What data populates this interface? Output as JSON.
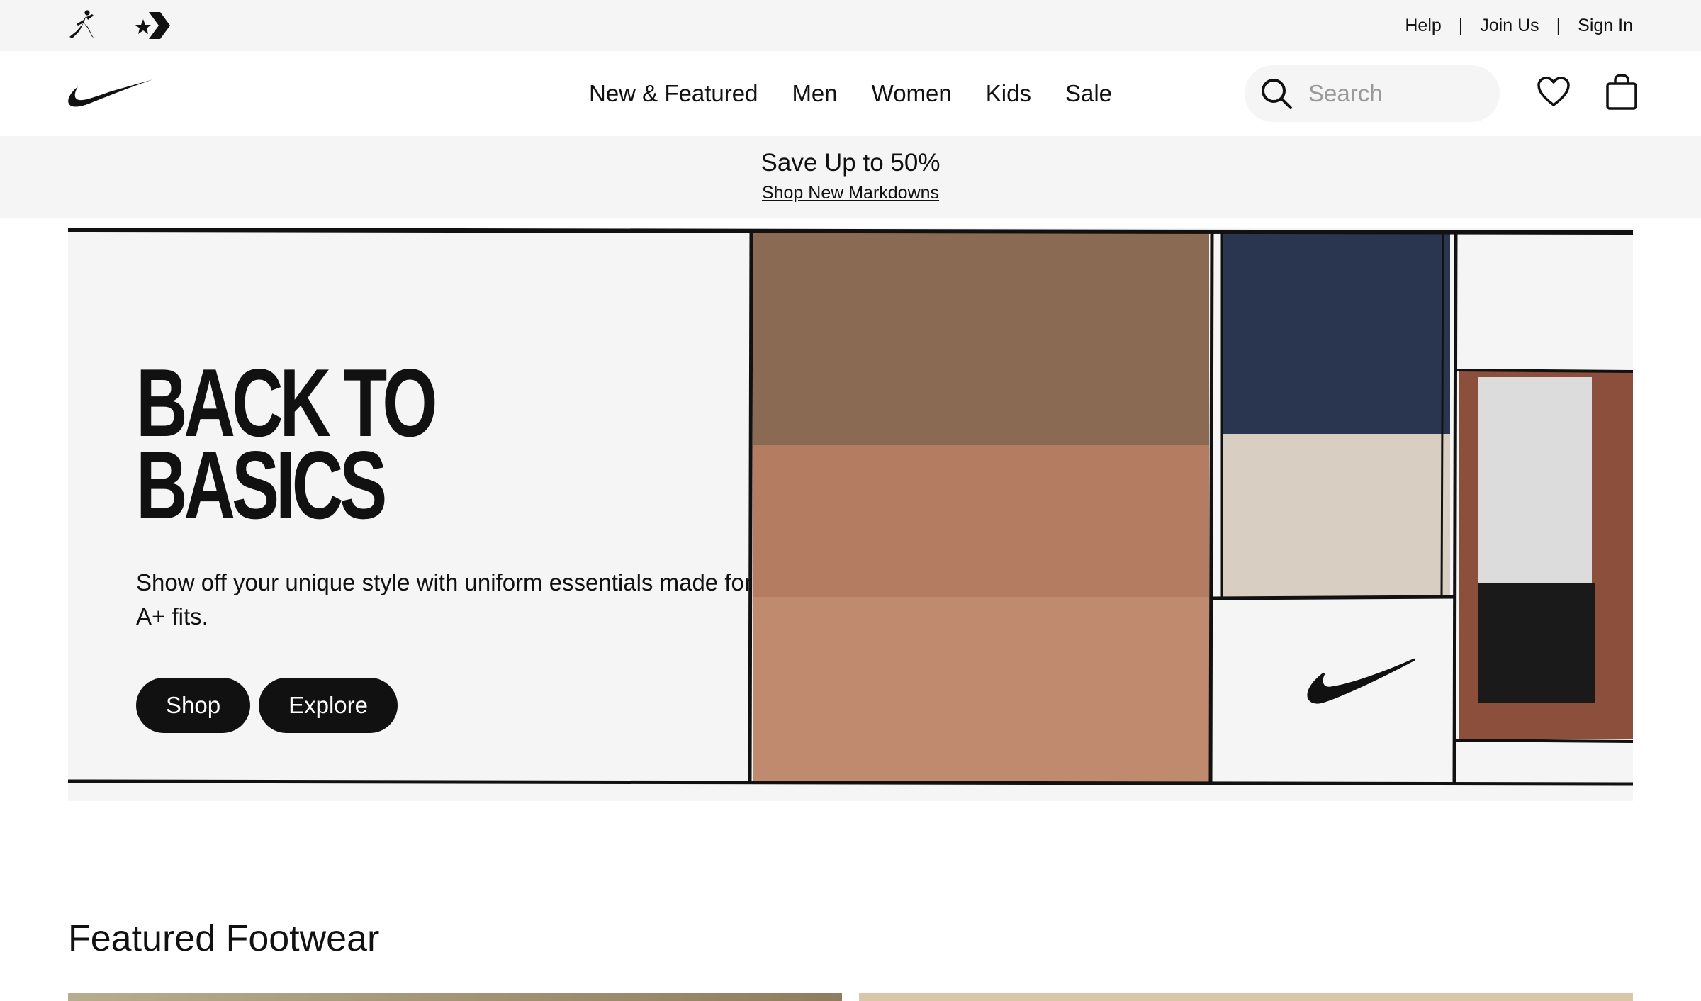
{
  "utility_bar": {
    "brands": [
      {
        "icon": "jordan-jumpman-icon"
      },
      {
        "icon": "converse-star-chevron-icon"
      }
    ],
    "links": [
      "Help",
      "Join Us",
      "Sign In"
    ],
    "separator": "|"
  },
  "nav": {
    "logo_icon": "nike-swoosh-icon",
    "menu": [
      "New & Featured",
      "Men",
      "Women",
      "Kids",
      "Sale"
    ],
    "search_placeholder": "Search",
    "icons": [
      "search-icon",
      "heart-icon",
      "bag-icon"
    ]
  },
  "promo": {
    "headline": "Save Up to 50%",
    "link": "Shop New Markdowns"
  },
  "hero": {
    "title_line1": "BACK TO",
    "title_line2": "BASICS",
    "description": "Show off your unique style with uniform essentials made for A+ fits.",
    "buttons": [
      "Shop",
      "Explore"
    ]
  },
  "featured": {
    "title": "Featured Footwear"
  },
  "colors": {
    "text": "#111111",
    "background_gray": "#f5f5f5",
    "button_bg": "#111111",
    "button_text": "#ffffff",
    "placeholder": "#9a9a9a"
  }
}
